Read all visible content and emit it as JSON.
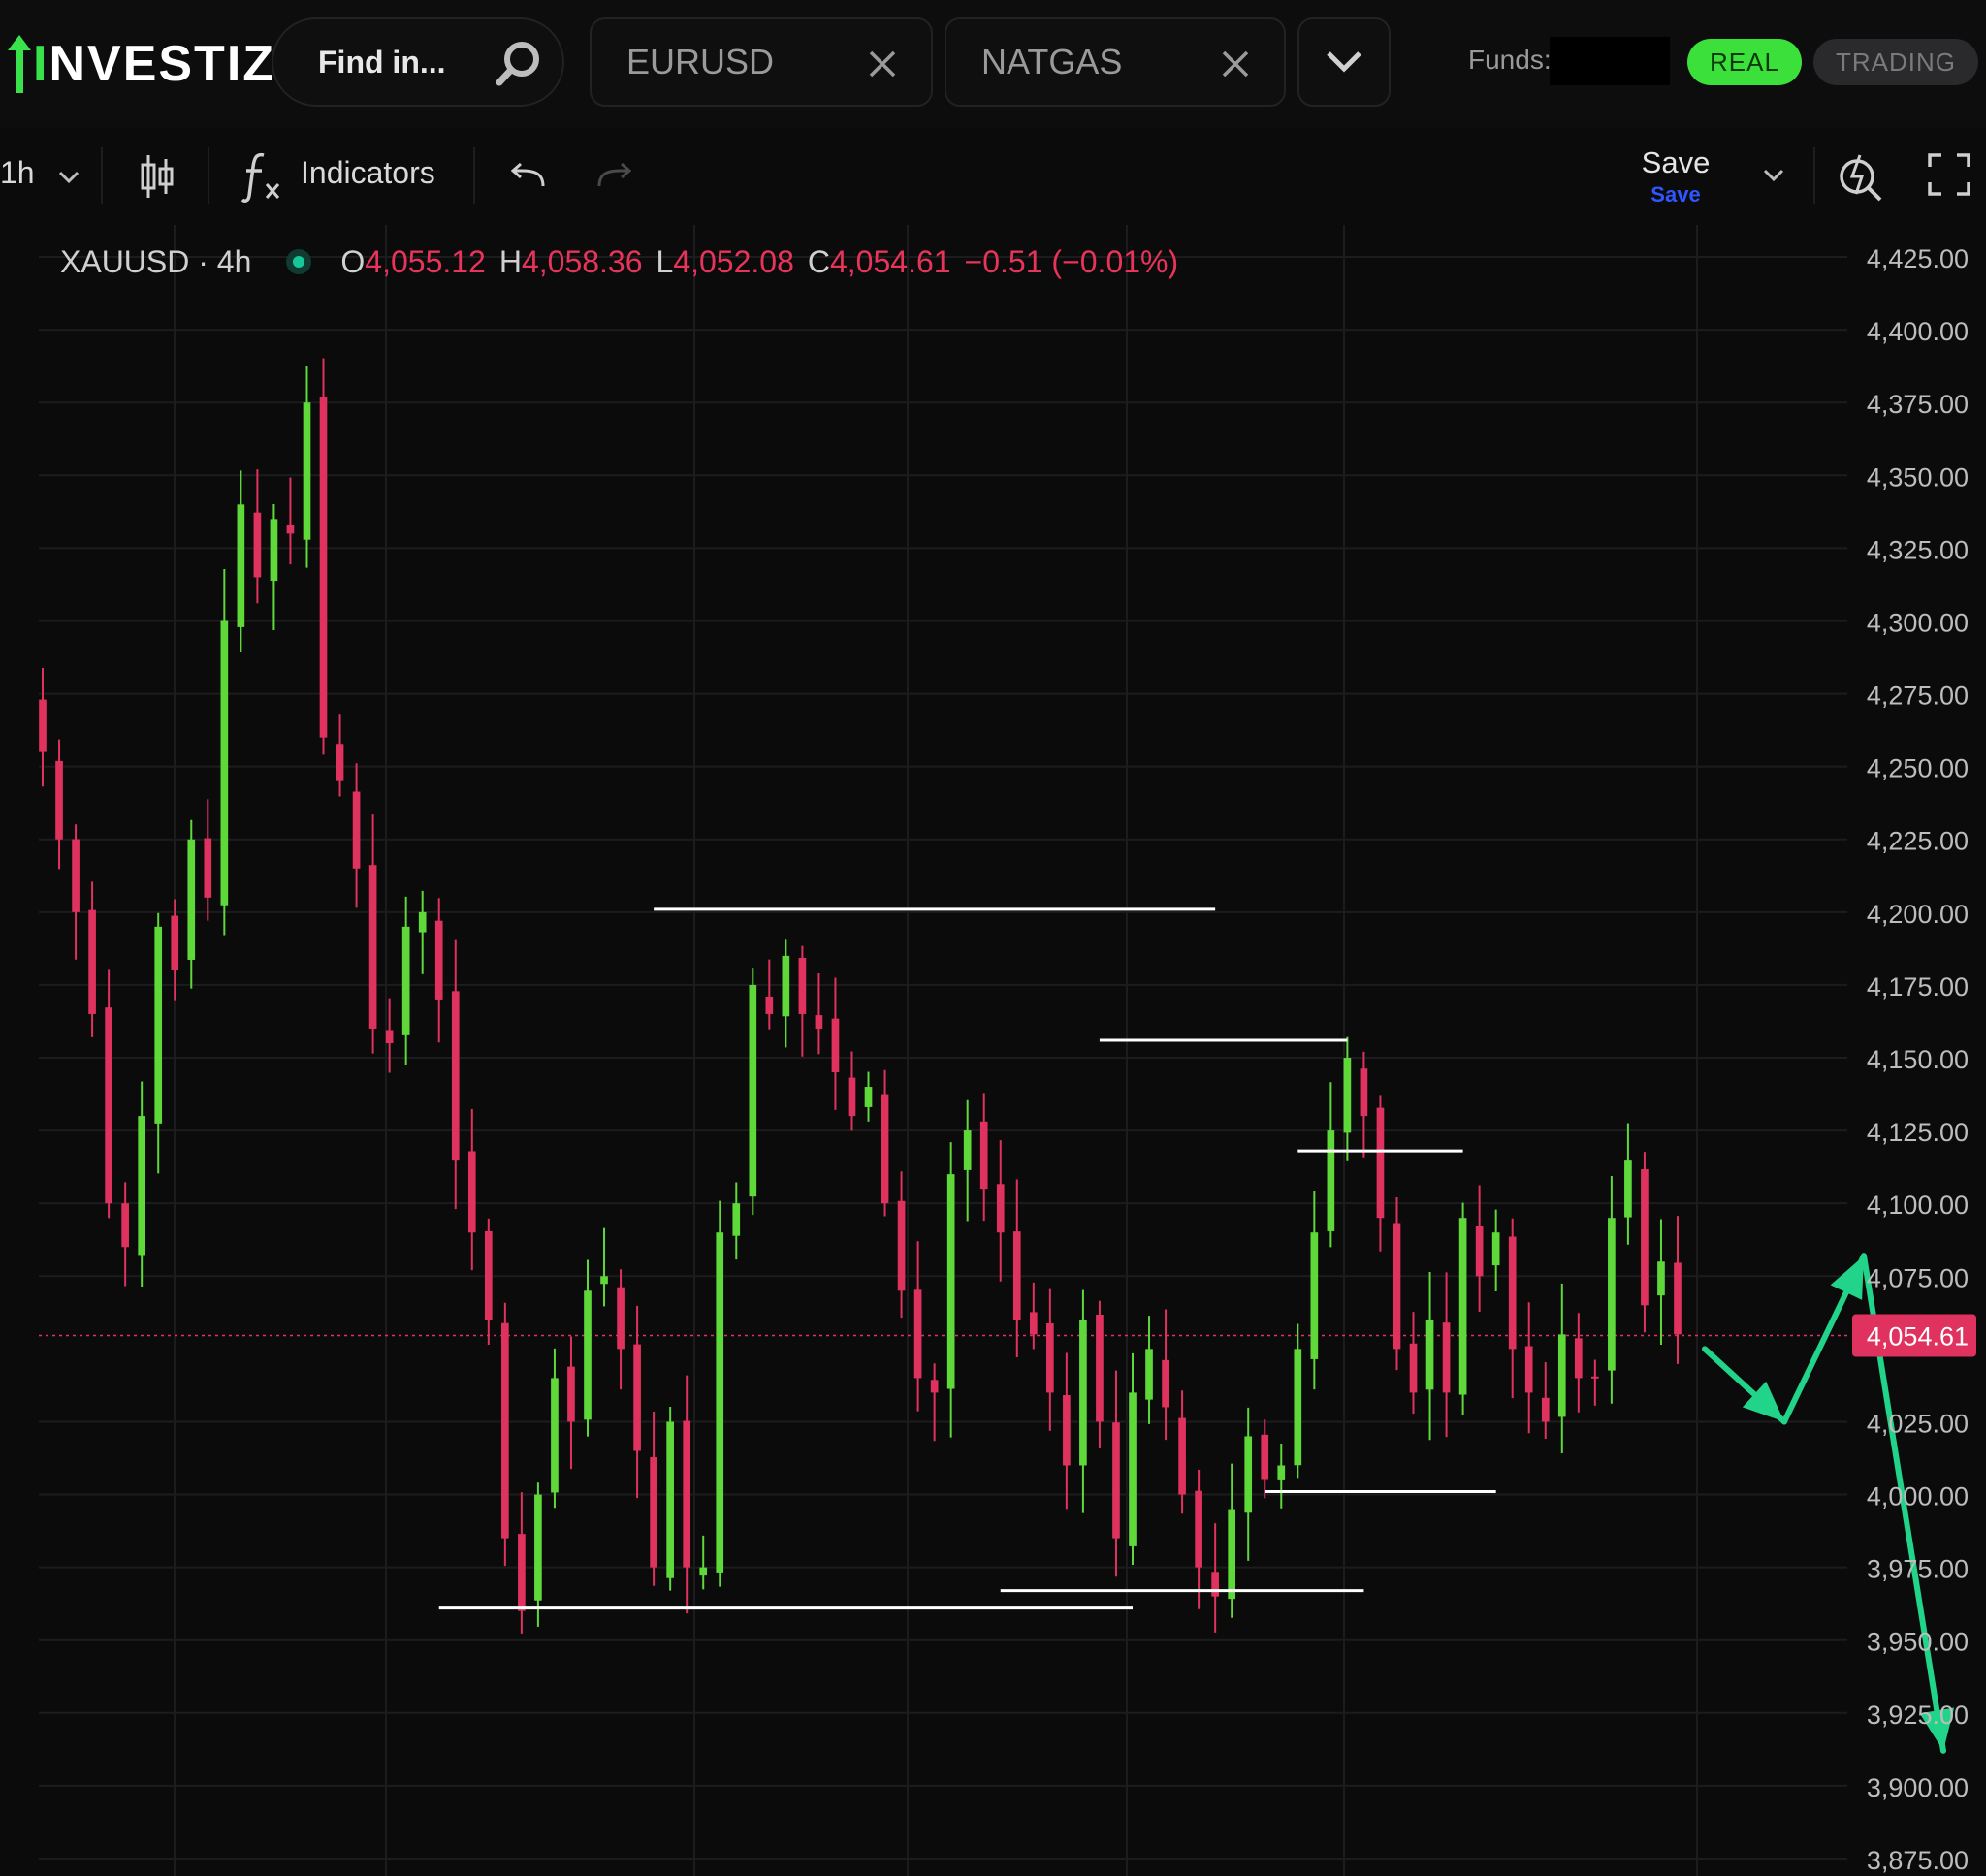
{
  "brand": {
    "name": "INVESTIZO"
  },
  "search": {
    "placeholder": "Find in..."
  },
  "tabs": [
    {
      "label": "EURUSD"
    },
    {
      "label": "NATGAS"
    }
  ],
  "account": {
    "funds_label": "Funds:",
    "mode_real": "REAL",
    "mode_trading": "TRADING"
  },
  "toolbar": {
    "interval": "1h",
    "indicators_label": "Indicators",
    "save_label": "Save",
    "save_sub_label": "Save"
  },
  "legend": {
    "symbol": "XAUUSD · 4h",
    "o_label": "O",
    "o_value": "4,055.12",
    "h_label": "H",
    "h_value": "4,058.36",
    "l_label": "L",
    "l_value": "4,052.08",
    "c_label": "C",
    "c_value": "4,054.61",
    "change": "−0.51 (−0.01%)"
  },
  "colors": {
    "up": "#5fd93a",
    "down": "#e0325e",
    "price_label_bg": "#e0325e",
    "projection_arrow": "#22d38a",
    "annotation_line": "#ffffff",
    "grid": "#1c1c1e"
  },
  "icons": [
    "logo-arrow-icon",
    "search-icon",
    "close-icon",
    "chevron-down-icon",
    "candles-icon",
    "function-icon",
    "undo-icon",
    "redo-icon",
    "alert-icon",
    "fullscreen-icon"
  ],
  "chart_data": {
    "type": "candlestick",
    "symbol": "XAUUSD",
    "timeframe": "4h",
    "y_ticks": [
      4425,
      4400,
      4375,
      4350,
      4325,
      4300,
      4275,
      4250,
      4225,
      4200,
      4175,
      4150,
      4125,
      4100,
      4075,
      4054.61,
      4025,
      4000,
      3975,
      3950,
      3925,
      3900,
      3875
    ],
    "y_tick_labels": [
      "4,425.00",
      "4,400.00",
      "4,375.00",
      "4,350.00",
      "4,325.00",
      "4,300.00",
      "4,275.00",
      "4,250.00",
      "4,225.00",
      "4,200.00",
      "4,175.00",
      "4,150.00",
      "4,125.00",
      "4,100.00",
      "4,075.00",
      "4,054.61",
      "4,025.00",
      "4,000.00",
      "3,975.00",
      "3,950.00",
      "3,925.00",
      "3,900.00",
      "3,875.00"
    ],
    "ylim": [
      3869,
      4436
    ],
    "last_price": 4054.61,
    "last_price_label": "4,054.61",
    "grid": true,
    "closes": [
      4255,
      4225,
      4200,
      4165,
      4100,
      4085,
      4130,
      4195,
      4180,
      4225,
      4205,
      4300,
      4340,
      4315,
      4335,
      4330,
      4375,
      4260,
      4245,
      4215,
      4160,
      4155,
      4195,
      4200,
      4170,
      4115,
      4090,
      4060,
      3985,
      3960,
      4000,
      4040,
      4025,
      4070,
      4075,
      4050,
      4015,
      3975,
      4025,
      3975,
      3975,
      4090,
      4100,
      4175,
      4165,
      4185,
      4165,
      4160,
      4145,
      4130,
      4140,
      4100,
      4070,
      4040,
      4035,
      4110,
      4125,
      4105,
      4090,
      4060,
      4055,
      4035,
      4010,
      4060,
      4025,
      3985,
      4035,
      4050,
      4030,
      4000,
      3975,
      3965,
      3995,
      4020,
      4005,
      4010,
      4050,
      4090,
      4125,
      4150,
      4130,
      4095,
      4050,
      4035,
      4060,
      4035,
      4095,
      4075,
      4090,
      4050,
      4035,
      4025,
      4055,
      4040,
      4040,
      4095,
      4115,
      4065,
      4080,
      4055
    ]
  },
  "annotations": {
    "levels": [
      {
        "price": 4201,
        "from_candle": 37,
        "to_candle": 71
      },
      {
        "price": 4156,
        "from_candle": 64,
        "to_candle": 79
      },
      {
        "price": 4118,
        "from_candle": 76,
        "to_candle": 86
      },
      {
        "price": 4001,
        "from_candle": 74,
        "to_candle": 88
      },
      {
        "price": 3967,
        "from_candle": 58,
        "to_candle": 80
      },
      {
        "price": 3961,
        "from_candle": 24,
        "to_candle": 66
      }
    ],
    "projection": [
      {
        "step": 0,
        "price": 4050
      },
      {
        "step": 1,
        "price": 4025
      },
      {
        "step": 2,
        "price": 4082
      },
      {
        "step": 3,
        "price": 3912
      }
    ]
  }
}
